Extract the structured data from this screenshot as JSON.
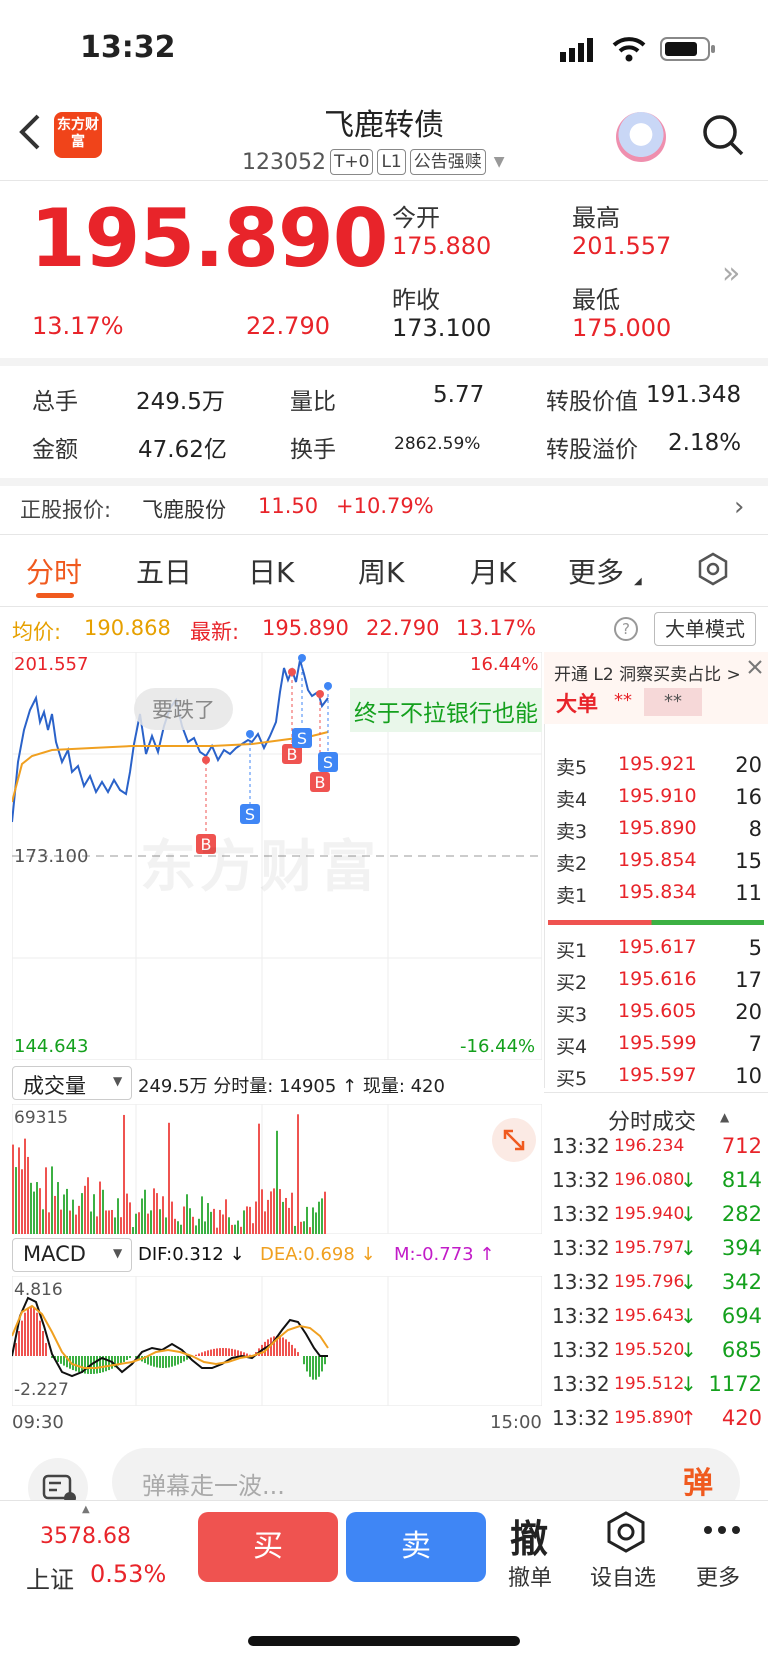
{
  "status_bar": {
    "time": "13:32"
  },
  "header": {
    "logo_text": "东方财富",
    "title": "飞鹿转债",
    "code": "123052",
    "tags": [
      "T+0",
      "L1",
      "公告强赎"
    ]
  },
  "quote": {
    "price": "195.890",
    "change_pct": "13.17%",
    "change": "22.790",
    "open_label": "今开",
    "open": "175.880",
    "high_label": "最高",
    "high": "201.557",
    "prev_close_label": "昨收",
    "prev_close": "173.100",
    "low_label": "最低",
    "low": "175.000"
  },
  "stats": {
    "volume_label": "总手",
    "volume": "249.5万",
    "vol_ratio_label": "量比",
    "vol_ratio": "5.77",
    "conv_value_label": "转股价值",
    "conv_value": "191.348",
    "amount_label": "金额",
    "amount": "47.62亿",
    "turnover_label": "换手",
    "turnover": "2862.59%",
    "premium_label": "转股溢价",
    "premium": "2.18%"
  },
  "underlying": {
    "label": "正股报价:",
    "name": "飞鹿股份",
    "price": "11.50",
    "change_pct": "+10.79%"
  },
  "tabs": [
    {
      "label": "分时"
    },
    {
      "label": "五日"
    },
    {
      "label": "日K"
    },
    {
      "label": "周K"
    },
    {
      "label": "月K"
    },
    {
      "label": "更多"
    }
  ],
  "intraday": {
    "avg_label": "均价:",
    "avg": "190.868",
    "last_label": "最新:",
    "last": "195.890",
    "last_change": "22.790",
    "last_pct": "13.17%",
    "mode_button": "大单模式",
    "y_top": "201.557",
    "y_mid": "173.100",
    "y_bottom": "144.643",
    "pct_top": "16.44%",
    "pct_bottom": "-16.44%",
    "bubble_1": "要跌了",
    "bubble_2": "终于不拉银行也能",
    "watermark": "东方财富",
    "marker_buy": "B",
    "marker_sell": "S"
  },
  "volume_panel": {
    "selector": "成交量",
    "summary": "249.5万 分时量: 14905 ↑ 现量: 420",
    "max": "69315"
  },
  "macd_panel": {
    "selector": "MACD",
    "dif": "DIF:0.312 ↓",
    "dea": "DEA:0.698 ↓",
    "m": "M:-0.773 ↑",
    "y_top": "4.816",
    "y_bottom": "-2.227",
    "time_start": "09:30",
    "time_end": "15:00",
    "colors": {
      "dif": "#111111",
      "dea": "#f0a020",
      "m": "#c21cc8"
    }
  },
  "order_book": {
    "l2_banner": "开通 L2 洞察买卖占比 >",
    "big_order_label": "大单",
    "big_order_buy": "**",
    "big_order_sell": "**",
    "asks": [
      {
        "label": "卖5",
        "price": "195.921",
        "vol": "20"
      },
      {
        "label": "卖4",
        "price": "195.910",
        "vol": "16"
      },
      {
        "label": "卖3",
        "price": "195.890",
        "vol": "8"
      },
      {
        "label": "卖2",
        "price": "195.854",
        "vol": "15"
      },
      {
        "label": "卖1",
        "price": "195.834",
        "vol": "11"
      }
    ],
    "bids": [
      {
        "label": "买1",
        "price": "195.617",
        "vol": "5"
      },
      {
        "label": "买2",
        "price": "195.616",
        "vol": "17"
      },
      {
        "label": "买3",
        "price": "195.605",
        "vol": "20"
      },
      {
        "label": "买4",
        "price": "195.599",
        "vol": "7"
      },
      {
        "label": "买5",
        "price": "195.597",
        "vol": "10"
      }
    ]
  },
  "trades": {
    "title": "分时成交",
    "rows": [
      {
        "time": "13:32",
        "price": "196.234",
        "arrow": "",
        "vol": "712",
        "dir": "up"
      },
      {
        "time": "13:32",
        "price": "196.080",
        "arrow": "↓",
        "vol": "814",
        "dir": "down"
      },
      {
        "time": "13:32",
        "price": "195.940",
        "arrow": "↓",
        "vol": "282",
        "dir": "down"
      },
      {
        "time": "13:32",
        "price": "195.797",
        "arrow": "↓",
        "vol": "394",
        "dir": "down"
      },
      {
        "time": "13:32",
        "price": "195.796",
        "arrow": "↓",
        "vol": "342",
        "dir": "down"
      },
      {
        "time": "13:32",
        "price": "195.643",
        "arrow": "↓",
        "vol": "694",
        "dir": "down"
      },
      {
        "time": "13:32",
        "price": "195.520",
        "arrow": "↓",
        "vol": "685",
        "dir": "down"
      },
      {
        "time": "13:32",
        "price": "195.512",
        "arrow": "↓",
        "vol": "1172",
        "dir": "down"
      },
      {
        "time": "13:32",
        "price": "195.890",
        "arrow": "↑",
        "vol": "420",
        "dir": "up"
      }
    ]
  },
  "bottom": {
    "danmu_placeholder": "弹幕走一波...",
    "danmu_button": "弹",
    "index_value": "3578.68",
    "index_name": "上证",
    "index_pct": "0.53%",
    "buy": "买",
    "sell": "卖",
    "cancel_icon_char": "撤",
    "cancel_label": "撤单",
    "watchlist_label": "设自选",
    "more_label": "更多"
  }
}
